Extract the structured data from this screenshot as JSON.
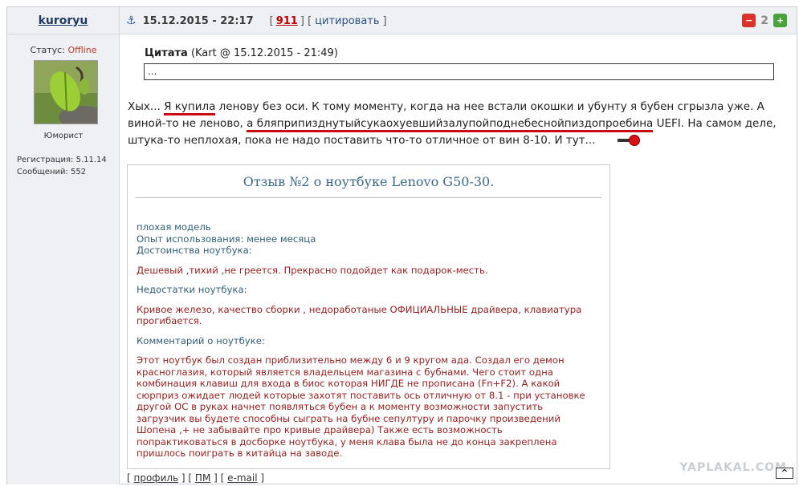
{
  "post": {
    "author": "kuroryu",
    "date": "15.12.2015 - 22:17",
    "post_number": "911",
    "quote_label": "цитировать",
    "rating": "2",
    "rate_down_glyph": "−",
    "rate_up_glyph": "+",
    "user": {
      "status_label": "Статус:",
      "status_value": "Offline",
      "rank": "Юморист",
      "registration": "Регистрация: 5.11.14",
      "messages": "Сообщений: 552"
    },
    "quote": {
      "title": "Цитата",
      "source": "(Kart @ 15.12.2015 - 21:49)",
      "content": "..."
    },
    "body": {
      "p1_a": "Хых... ",
      "p1_hl1": "Я купила",
      "p1_b": " ленову без оси. К тому моменту, когда на нее встали окошки и убунту я бубен сгрызла уже. А виной-то не леново, ",
      "p1_hl2": "а бляприпизднутыйсукаохуевшийзалупойподнебеснойпиздопроебина",
      "p1_c": " UEFI. На самом деле, штука-то неплохая, пока не надо поставить что-то отличное от вин 8-10. И тут..."
    },
    "review": {
      "title": "Отзыв №2 о ноутбуке Lenovo G50-30.",
      "line1": "плохая модель",
      "line2": "Опыт использования: менее месяца",
      "line3": "Достоинства ноутбука:",
      "pros": "Дешевый ,тихий ,не греется. Прекрасно подойдет как подарок-месть.",
      "cons_label": "Недостатки ноутбука:",
      "cons": "Кривое железо, качество сборки , недоработаные ОФИЦИАЛЬНЫЕ драйвера, клавиатура прогибается.",
      "comment_label": "Комментарий о ноутбуке:",
      "comment": "Этот ноутбук был создан приблизительно между 6 и 9 кругом ада. Создал его демон красноглазия, который является владельцем магазина с бубнами. Чего стоит одна комбинация клавиш для входа в биос которая НИГДЕ не прописана (Fn+F2). А какой сюрприз ожидает людей которые захотят поставить ось отличную от 8.1 - при установке другой ОС в руках начнет появляться бубен а к моменту возможности запустить загрузчик вы будете способны сыграть на бубне сепултуру и парочку произведений Шопена ,+ не забывайте про кривые драйвера) Также есть возможность попрактиковаться в досборке ноутбука, у меня клава была не до конца закреплена пришлось поиграть в китайца на заводе."
    },
    "footer": {
      "profile": "профиль",
      "pm": "ПМ",
      "email": "e-mail",
      "up": "^"
    },
    "watermark": "YAPLAKAL.COM"
  },
  "colors": {
    "header_bg": "#eef0f3",
    "offline": "#c0392b",
    "post_number": "#c00000",
    "highlight": "#cc0a14",
    "review_blue": "#2f5f78",
    "review_red": "#9a2020"
  }
}
